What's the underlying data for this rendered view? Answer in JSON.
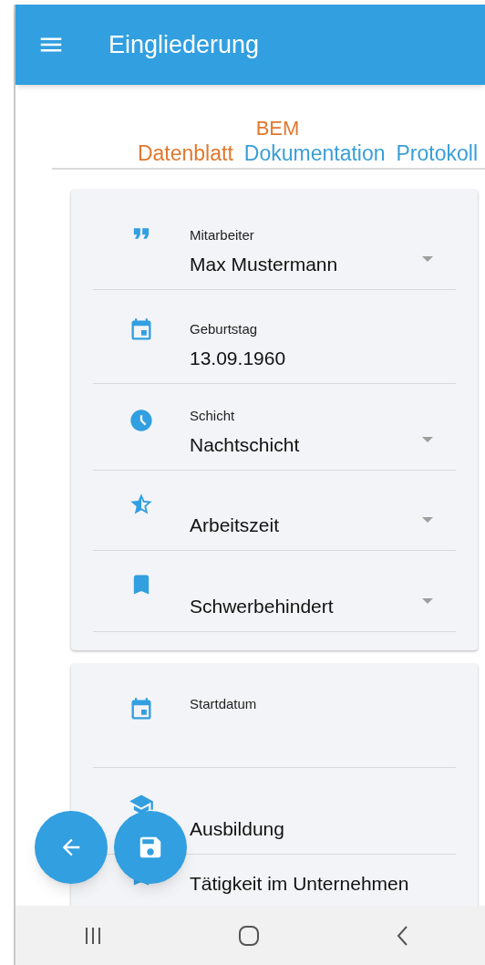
{
  "app_bar": {
    "title": "Eingliederung"
  },
  "heading": "BEM",
  "tabs": [
    {
      "label": "Datenblatt",
      "selected": true
    },
    {
      "label": "Dokumentation",
      "selected": false
    },
    {
      "label": "Protokoll",
      "selected": false
    }
  ],
  "cards": [
    {
      "fields": [
        {
          "label": "Mitarbeiter",
          "value": "Max Mustermann",
          "dropdown": true
        },
        {
          "label": "Geburtstag",
          "value": "13.09.1960",
          "dropdown": false
        },
        {
          "label": "Schicht",
          "value": "Nachtschicht",
          "dropdown": true
        },
        {
          "value": "Arbeitszeit",
          "dropdown": true
        },
        {
          "value": "Schwerbehindert",
          "dropdown": true
        }
      ]
    },
    {
      "fields": [
        {
          "label": "Startdatum",
          "dropdown": false
        },
        {
          "value": "Ausbildung",
          "dropdown": false
        },
        {
          "value": "Tätigkeit im Unternehmen",
          "dropdown": false
        }
      ]
    }
  ]
}
